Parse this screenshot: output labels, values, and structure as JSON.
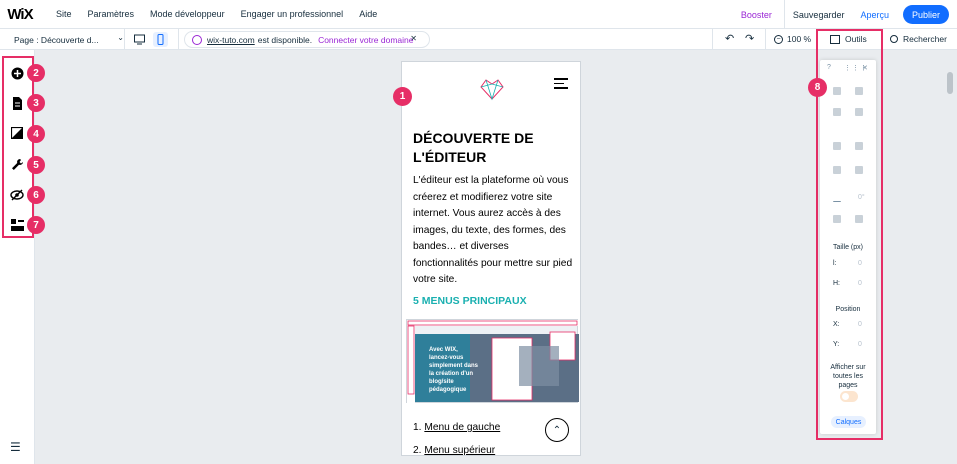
{
  "topbar": {
    "logo": "WiX",
    "menu": [
      "Site",
      "Paramètres",
      "Mode développeur",
      "Engager un professionnel",
      "Aide"
    ],
    "booster": "Booster",
    "save": "Sauvegarder",
    "preview": "Aperçu",
    "publish": "Publier"
  },
  "secbar": {
    "page": "Page : Découverte d...",
    "domain_url": "wix-tuto.com",
    "domain_text": "est disponible.",
    "domain_link": "Connecter votre domaine",
    "zoom": "100 %",
    "tools": "Outils",
    "search": "Rechercher"
  },
  "badges": [
    "1",
    "2",
    "3",
    "4",
    "5",
    "6",
    "7",
    "8"
  ],
  "canvas": {
    "title": "DÉCOUVERTE DE L'ÉDITEUR",
    "paragraph": "L'éditeur est la plateforme où vous créerez et modifierez votre site internet. Vous aurez accès à des images, du texte, des formes, des bandes… et diverses fonctionnalités pour mettre sur pied votre site.",
    "heading2": "5 MENUS PRINCIPAUX",
    "thumb_text": "Avec WIX, lancez-vous simplement dans la création d'un blog/site pédagogique",
    "item1_num": "1.",
    "item1": "Menu de gauche",
    "item2_num": "2.",
    "item2": "Menu supérieur"
  },
  "tools": {
    "help": "?",
    "size_label": "Taille (px)",
    "w_label": "l:",
    "w_value": "0",
    "h_label": "H:",
    "h_value": "0",
    "rotation": "0°",
    "position_label": "Position",
    "x_label": "X:",
    "x_value": "0",
    "y_label": "Y:",
    "y_value": "0",
    "show_all": "Afficher sur toutes les pages",
    "layers": "Calques"
  },
  "colors": {
    "accent": "#116dff",
    "highlight": "#e62e66",
    "teal": "#1ab0b0",
    "purple": "#9a27d5"
  }
}
